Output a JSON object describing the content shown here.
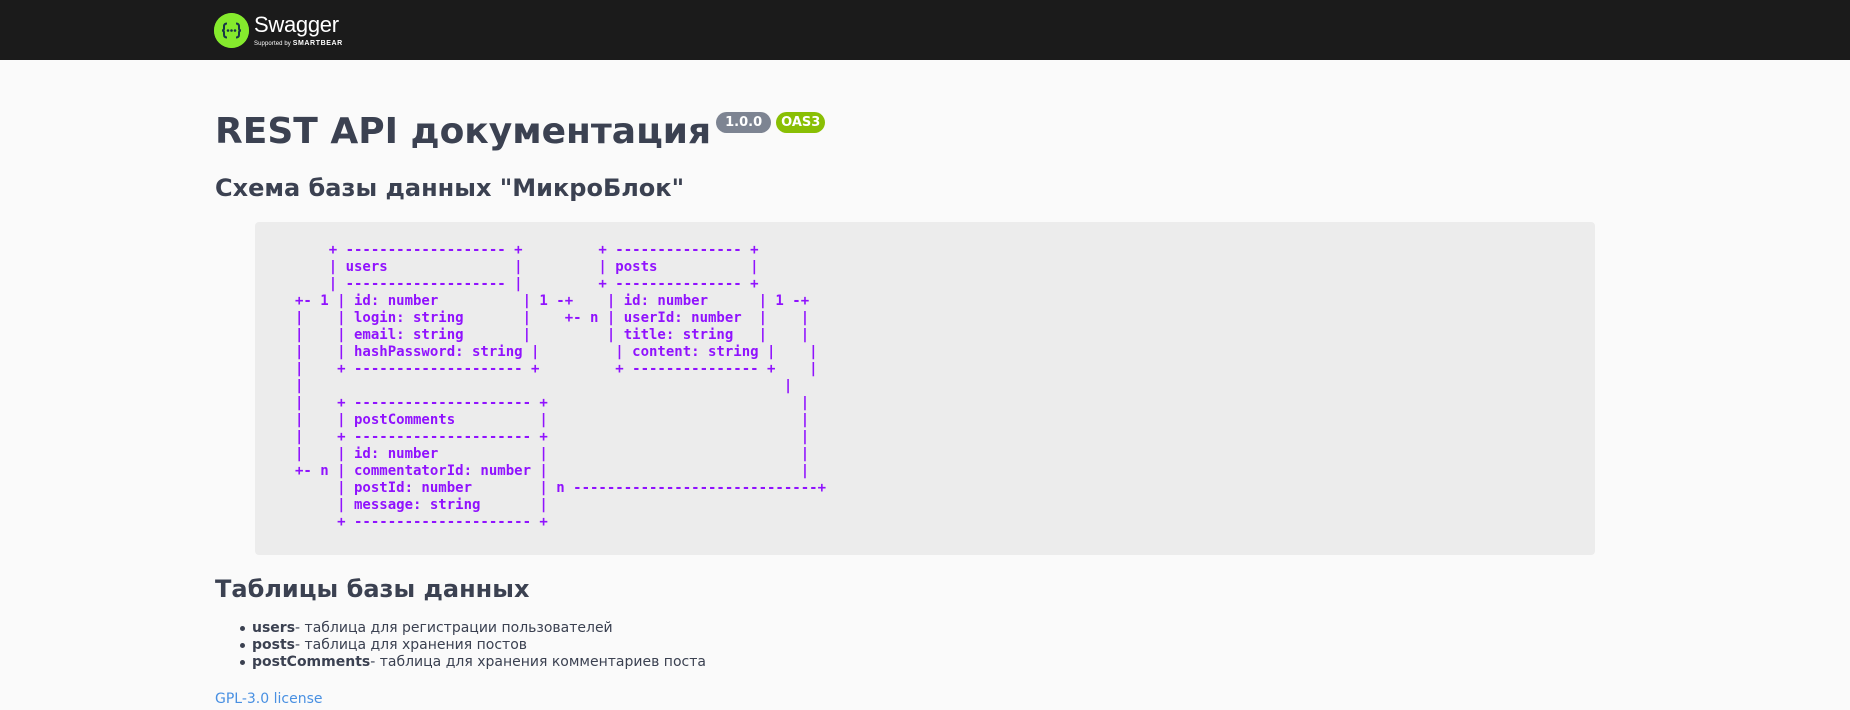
{
  "topbar": {
    "brand_name": "Swagger",
    "brand_sub_prefix": "Supported by",
    "brand_sub_company": "SMARTBEAR",
    "background": "#1b1b1b",
    "logo_color": "#85ea2d"
  },
  "info": {
    "title": "REST API документация",
    "version_badge": "1.0.0",
    "oas_badge": "OAS3",
    "version_badge_color": "#7d8492",
    "oas_badge_color": "#89bf04"
  },
  "schema": {
    "heading": "Схема базы данных \"МикроБлок\"",
    "diagram_color": "#9012fe",
    "diagram_lines": [
      "    + ------------------- +         + --------------- +",
      "    | users               |         | posts           |",
      "    | ------------------- |         + --------------- +",
      "+- 1 | id: number          | 1 -+    | id: number      | 1 -+",
      "|    | login: string       |    +- n | userId: number  |    |",
      "|    | email: string       |         | title: string   |    |",
      "|    | hashPassword: string |         | content: string |    |",
      "|    + -------------------- +         + --------------- +    |",
      "|                                                         |",
      "|    + --------------------- +                              |",
      "|    | postComments          |                              |",
      "|    + --------------------- +                              |",
      "|    | id: number            |                              |",
      "+- n | commentatorId: number |                              |",
      "     | postId: number        | n -----------------------------+",
      "     | message: string       |",
      "     + --------------------- +"
    ]
  },
  "tables": {
    "heading": "Таблицы базы данных",
    "items": [
      {
        "name": "users",
        "description": " - таблица для регистрации пользователей"
      },
      {
        "name": "posts",
        "description": " - таблица для хранения постов"
      },
      {
        "name": "postComments",
        "description": " - таблица для хранения комментариев поста"
      }
    ]
  },
  "footer": {
    "license_label": "GPL-3.0 license",
    "link_color": "#4990e2"
  }
}
